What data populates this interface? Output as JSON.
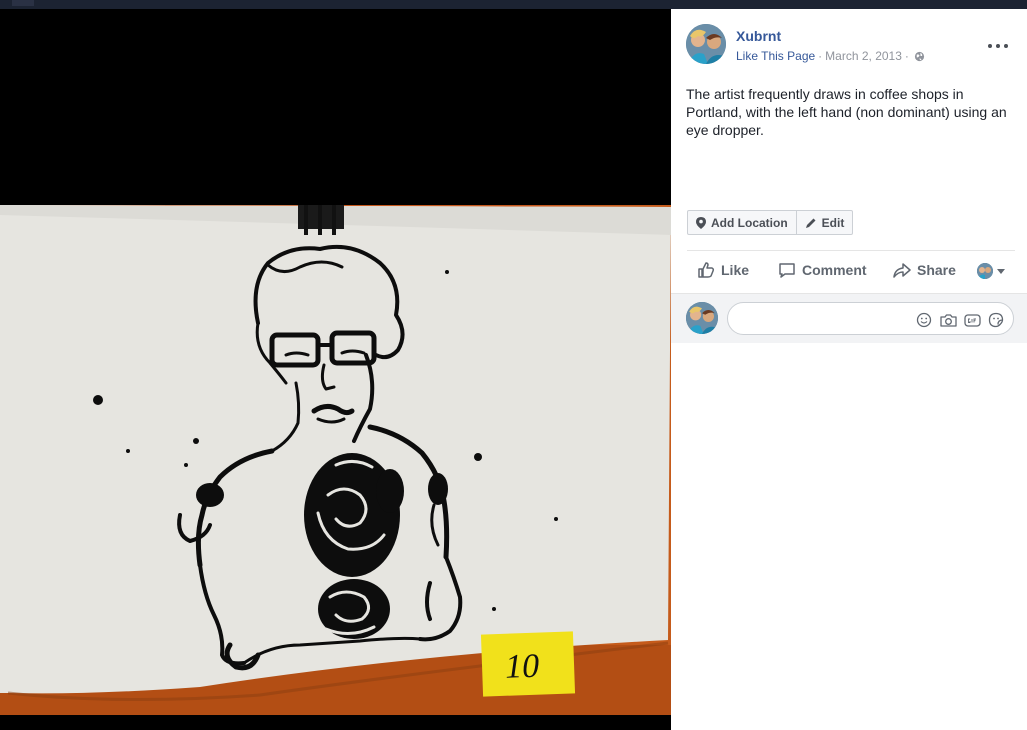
{
  "post": {
    "page_name": "Xubrnt",
    "like_page": "Like This Page",
    "separator": "·",
    "date": "March 2, 2013",
    "description": "The artist frequently draws in coffee shops in Portland, with the left hand (non dominant) using an eye dropper.",
    "photo_number": "10"
  },
  "actions": {
    "add_location": "Add Location",
    "edit": "Edit"
  },
  "ufi": {
    "like": "Like",
    "comment": "Comment",
    "share": "Share"
  },
  "composer": {
    "placeholder": ""
  },
  "icons": [
    "more-icon",
    "globe-icon",
    "location-pin-icon",
    "pencil-icon",
    "thumbs-up-icon",
    "comment-bubble-icon",
    "share-arrow-icon",
    "emoji-icon",
    "camera-icon",
    "gif-icon",
    "sticker-icon"
  ],
  "colors": {
    "link": "#365899",
    "text": "#1d2129",
    "muted": "#90949c",
    "wall": "#c85a12",
    "paper": "#e8e7e2",
    "sticky": "#f2e21c"
  }
}
